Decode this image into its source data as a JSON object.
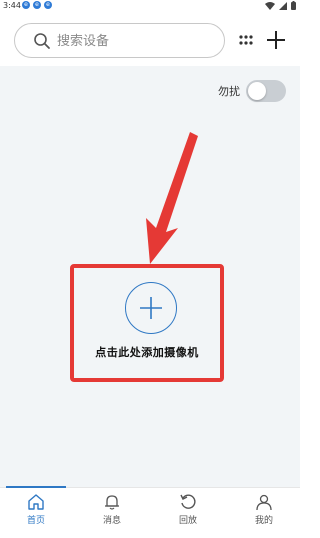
{
  "status_bar": {
    "time": "3:44",
    "notification_badges": [
      "e",
      "e",
      "e"
    ]
  },
  "header": {
    "search": {
      "placeholder": "搜索设备",
      "value": ""
    },
    "icons": [
      "search-icon",
      "grid-dots-icon",
      "plus-icon"
    ]
  },
  "main": {
    "dnd": {
      "label": "勿扰",
      "enabled": false
    },
    "add_camera": {
      "label": "点击此处添加摄像机"
    }
  },
  "bottom_nav": {
    "items": [
      {
        "label": "首页",
        "icon": "home-icon",
        "active": true
      },
      {
        "label": "消息",
        "icon": "bell-icon",
        "active": false
      },
      {
        "label": "回放",
        "icon": "replay-icon",
        "active": false
      },
      {
        "label": "我的",
        "icon": "person-icon",
        "active": false
      }
    ]
  },
  "colors": {
    "accent": "#2f78c4",
    "highlight": "#e53935",
    "content_bg": "#f2f5f7"
  }
}
